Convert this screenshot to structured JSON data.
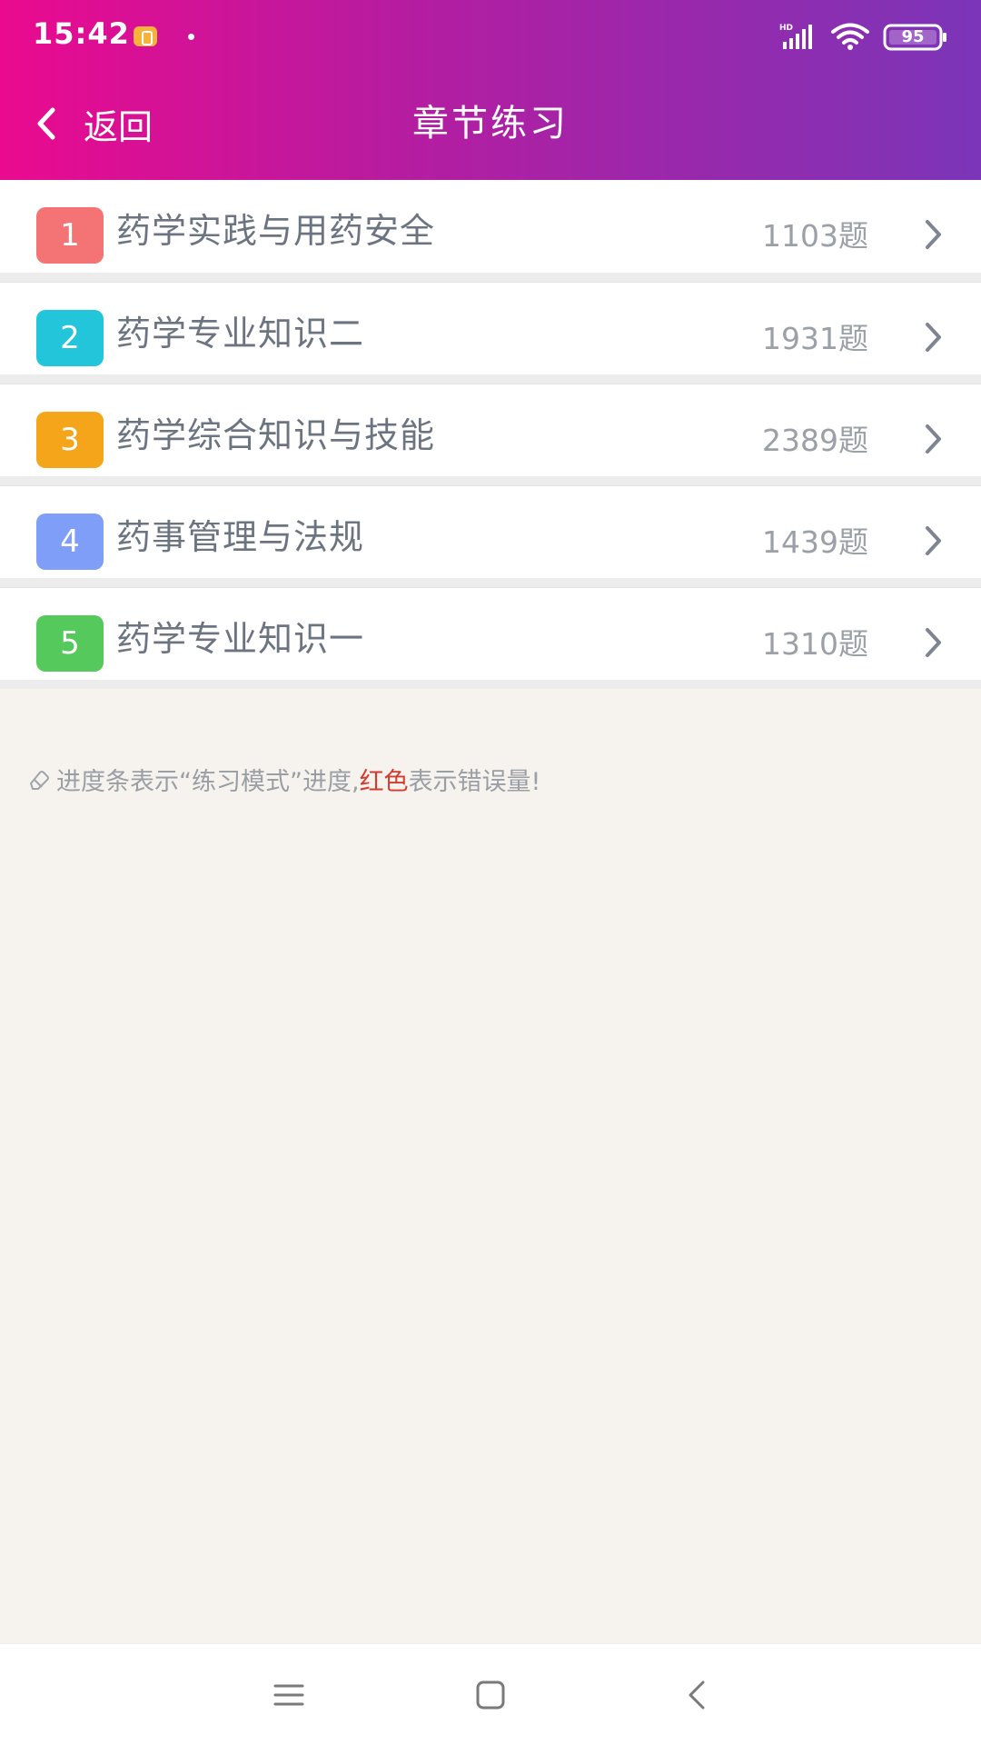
{
  "status_bar": {
    "time": "15:42",
    "network_badge": "HD",
    "battery": "95"
  },
  "header": {
    "back_label": "返回",
    "title": "章节练习"
  },
  "chapters": [
    {
      "number": "1",
      "title": "药学实践与用药安全",
      "count": "1103题",
      "color": "#f47476"
    },
    {
      "number": "2",
      "title": "药学专业知识二",
      "count": "1931题",
      "color": "#23c5db"
    },
    {
      "number": "3",
      "title": "药学综合知识与技能",
      "count": "2389题",
      "color": "#f5a51a"
    },
    {
      "number": "4",
      "title": "药事管理与法规",
      "count": "1439题",
      "color": "#7f9ef8"
    },
    {
      "number": "5",
      "title": "药学专业知识一",
      "count": "1310题",
      "color": "#55c95c"
    }
  ],
  "hint": {
    "text_before": "进度条表示“练习模式”进度,",
    "text_red": "红色",
    "text_after": "表示错误量!"
  },
  "colors": {
    "header_gradient_start": "#ea0a8f",
    "header_gradient_end": "#7b35b8",
    "background": "#f6f3ee",
    "error_red": "#d23b2e"
  }
}
